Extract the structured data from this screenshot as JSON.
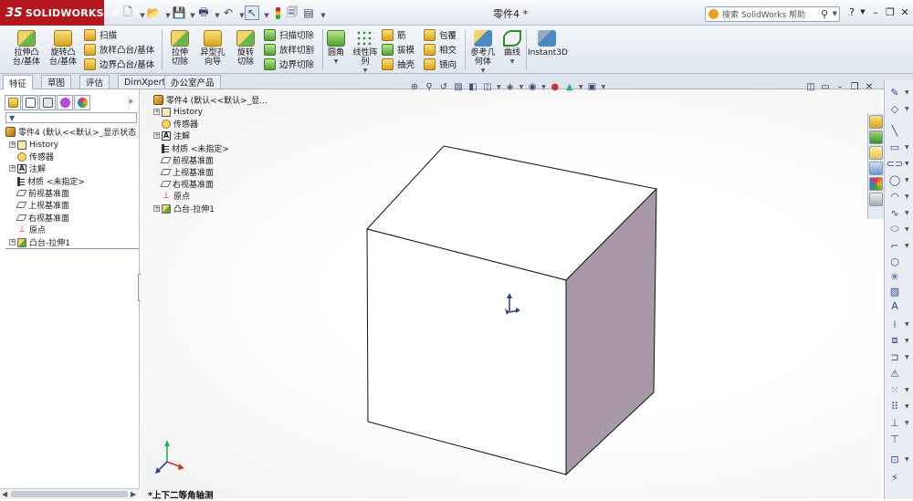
{
  "app": {
    "name": "SOLIDWORKS",
    "brand_prefix": "3S",
    "document_title": "零件4 *",
    "search_placeholder": "搜索 SolidWorks 帮助",
    "brand_color": "#b3171d"
  },
  "command_manager": {
    "big_buttons": [
      {
        "label": "拉伸凸台/基体",
        "icon": "extrude-boss-icon"
      },
      {
        "label": "旋转凸台/基体",
        "icon": "revolve-boss-icon"
      }
    ],
    "boss_small": [
      {
        "label": "扫描",
        "icon": "sweep-icon"
      },
      {
        "label": "放样凸台/基体",
        "icon": "loft-icon"
      },
      {
        "label": "边界凸台/基体",
        "icon": "boundary-boss-icon"
      }
    ],
    "cut_big": [
      {
        "label": "拉伸切除",
        "icon": "extrude-cut-icon"
      },
      {
        "label": "异型孔向导",
        "icon": "hole-wizard-icon"
      },
      {
        "label": "旋转切除",
        "icon": "revolve-cut-icon"
      }
    ],
    "cut_small": [
      {
        "label": "扫描切除",
        "icon": "swept-cut-icon"
      },
      {
        "label": "放样切割",
        "icon": "lofted-cut-icon"
      },
      {
        "label": "边界切除",
        "icon": "boundary-cut-icon"
      }
    ],
    "features_big": [
      {
        "label": "圆角",
        "icon": "fillet-icon"
      },
      {
        "label": "线性阵列",
        "icon": "linear-pattern-icon"
      }
    ],
    "features_small": [
      {
        "label": "筋",
        "icon": "rib-icon"
      },
      {
        "label": "拔模",
        "icon": "draft-icon"
      },
      {
        "label": "抽壳",
        "icon": "shell-icon"
      }
    ],
    "features_small_2": [
      {
        "label": "包覆",
        "icon": "wrap-icon"
      },
      {
        "label": "相交",
        "icon": "intersect-icon"
      },
      {
        "label": "镜向",
        "icon": "mirror-icon"
      }
    ],
    "ref_big": [
      {
        "label": "参考几何体",
        "icon": "reference-geometry-icon"
      },
      {
        "label": "曲线",
        "icon": "curves-icon"
      }
    ],
    "instant3d": {
      "label": "Instant3D",
      "icon": "instant3d-icon"
    }
  },
  "tabs": [
    {
      "label": "特征",
      "active": true
    },
    {
      "label": "草图",
      "active": false
    },
    {
      "label": "评估",
      "active": false
    },
    {
      "label": "DimXpert",
      "active": false
    },
    {
      "label": "办公室产品",
      "active": false
    }
  ],
  "feature_tree": {
    "root": "零件4  (默认<<默认>_显示状态",
    "items": [
      {
        "label": "History",
        "icon": "history-icon",
        "expandable": true
      },
      {
        "label": "传感器",
        "icon": "sensor-icon",
        "expandable": false
      },
      {
        "label": "注解",
        "icon": "annotation-icon",
        "expandable": true
      },
      {
        "label": "材质 <未指定>",
        "icon": "material-icon",
        "expandable": false
      },
      {
        "label": "前视基准面",
        "icon": "plane-icon",
        "expandable": false
      },
      {
        "label": "上视基准面",
        "icon": "plane-icon",
        "expandable": false
      },
      {
        "label": "右视基准面",
        "icon": "plane-icon",
        "expandable": false
      },
      {
        "label": "原点",
        "icon": "origin-icon",
        "expandable": false
      },
      {
        "label": "凸台-拉伸1",
        "icon": "extrude-feature-icon",
        "expandable": true
      }
    ]
  },
  "viewport_tree": {
    "root": "零件4  (默认<<默认>_显...",
    "items": [
      {
        "label": "History",
        "icon": "history-icon",
        "expandable": true
      },
      {
        "label": "传感器",
        "icon": "sensor-icon",
        "expandable": false
      },
      {
        "label": "注解",
        "icon": "annotation-icon",
        "expandable": true
      },
      {
        "label": "材质 <未指定>",
        "icon": "material-icon",
        "expandable": false
      },
      {
        "label": "前视基准面",
        "icon": "plane-icon",
        "expandable": false
      },
      {
        "label": "上视基准面",
        "icon": "plane-icon",
        "expandable": false
      },
      {
        "label": "右视基准面",
        "icon": "plane-icon",
        "expandable": false
      },
      {
        "label": "原点",
        "icon": "origin-icon",
        "expandable": false
      },
      {
        "label": "凸台-拉伸1",
        "icon": "extrude-feature-icon",
        "expandable": true
      }
    ]
  },
  "viewport": {
    "view_name": "*上下二等角轴测",
    "cube_face_top": "#ffffff",
    "cube_face_front": "#ffffff",
    "cube_face_right": "#a898a8",
    "triad_x_color": "#c0392b",
    "triad_y_color": "#27ae60",
    "triad_z_color": "#2c3e99"
  }
}
